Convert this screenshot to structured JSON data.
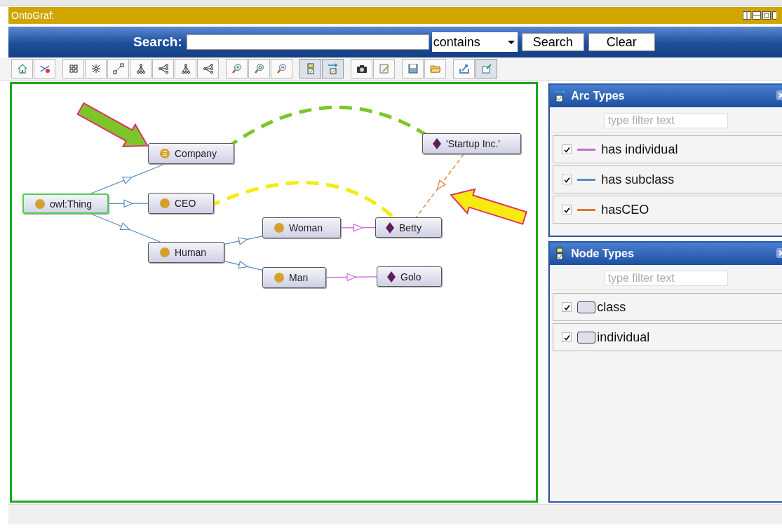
{
  "window": {
    "title": "OntoGraf:"
  },
  "search": {
    "label": "Search:",
    "mode": "contains",
    "buttons": [
      "Search",
      "Clear"
    ]
  },
  "toolbar": [
    [
      {
        "kind": "home",
        "selected": false
      },
      {
        "kind": "unlink",
        "selected": false
      }
    ],
    [
      {
        "kind": "grid",
        "selected": false
      },
      {
        "kind": "radial",
        "selected": false
      },
      {
        "kind": "spring",
        "selected": false
      },
      {
        "kind": "tree-down",
        "selected": false
      },
      {
        "kind": "tree-left",
        "selected": false
      },
      {
        "kind": "tree-down",
        "selected": false
      },
      {
        "kind": "tree-left",
        "selected": false
      }
    ],
    [
      {
        "kind": "zoom-in",
        "selected": false
      },
      {
        "kind": "zoom-reset",
        "selected": false
      },
      {
        "kind": "zoom-out",
        "selected": false
      }
    ],
    [
      {
        "kind": "node-filter",
        "selected": true
      },
      {
        "kind": "arc-filter",
        "selected": true
      }
    ],
    [
      {
        "kind": "camera",
        "selected": false
      },
      {
        "kind": "notes",
        "selected": false
      }
    ],
    [
      {
        "kind": "save",
        "selected": false
      },
      {
        "kind": "open",
        "selected": false
      }
    ],
    [
      {
        "kind": "export",
        "selected": false
      },
      {
        "kind": "pin",
        "selected": true
      }
    ]
  ],
  "graph": {
    "nodes": [
      {
        "label": "owl:Thing",
        "kind": "class",
        "selected": true
      },
      {
        "label": "Company",
        "kind": "class",
        "selected": false
      },
      {
        "label": "CEO",
        "kind": "class",
        "selected": false
      },
      {
        "label": "Human",
        "kind": "class",
        "selected": false
      },
      {
        "label": "Woman",
        "kind": "class",
        "selected": false
      },
      {
        "label": "Man",
        "kind": "class",
        "selected": false
      },
      {
        "label": "Betty",
        "kind": "individual",
        "selected": false
      },
      {
        "label": "Golo",
        "kind": "individual",
        "selected": false
      },
      {
        "label": "'Startup Inc.'",
        "kind": "individual",
        "selected": false
      }
    ]
  },
  "arc_types": {
    "title": "Arc Types",
    "placeholder": "type filter text",
    "items": [
      {
        "label": "has individual",
        "color": "#cc66dd",
        "checked": true
      },
      {
        "label": "has subclass",
        "color": "#5a8fc0",
        "checked": true
      },
      {
        "label": "hasCEO",
        "color": "#e07830",
        "checked": true
      }
    ]
  },
  "node_types": {
    "title": "Node Types",
    "placeholder": "type filter text",
    "items": [
      {
        "label": "class",
        "checked": true
      },
      {
        "label": "individual",
        "checked": true
      }
    ]
  }
}
